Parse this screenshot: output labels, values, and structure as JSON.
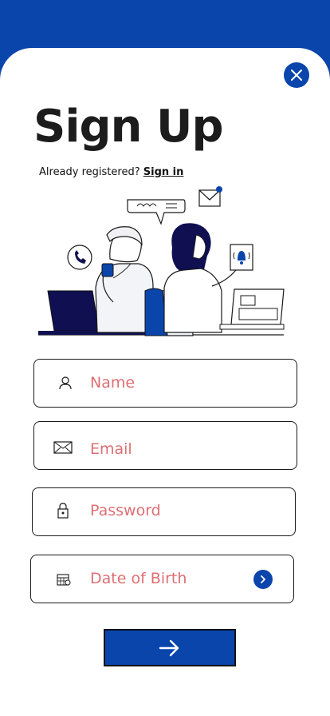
{
  "screen": {
    "title": "Sign Up",
    "prompt_text": "Already registered?",
    "signin_link": "Sign in",
    "accent_color": "#0a45ac",
    "placeholder_color": "#de6f73"
  },
  "icons": {
    "close": "close-icon",
    "name": "user-icon",
    "email": "mail-icon",
    "password": "lock-icon",
    "dob": "calendar-icon",
    "dob_action": "chevron-right-icon",
    "submit": "arrow-right-icon"
  },
  "form": {
    "name_placeholder": "Name",
    "email_placeholder": "Email",
    "password_placeholder": "Password",
    "dob_placeholder": "Date of Birth"
  }
}
